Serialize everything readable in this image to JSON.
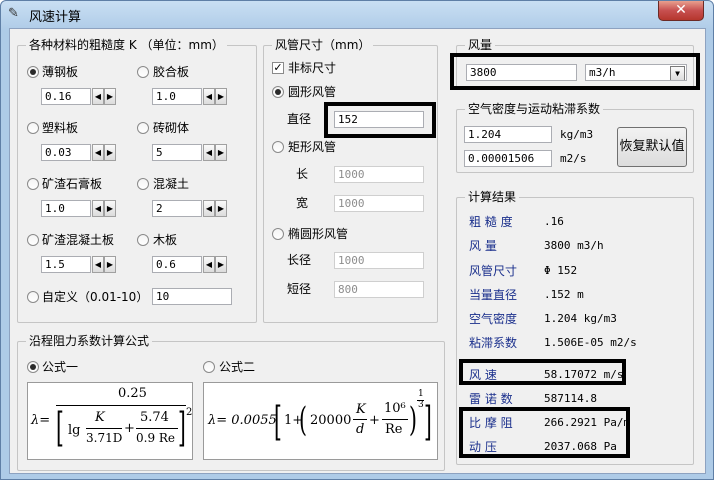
{
  "window": {
    "title": "风速计算",
    "close": "✕"
  },
  "materials": {
    "title": "各种材料的粗糙度 K  （单位：mm）",
    "items": [
      {
        "label": "薄钢板",
        "value": "0.16",
        "checked": true
      },
      {
        "label": "胶合板",
        "value": "1.0"
      },
      {
        "label": "塑料板",
        "value": "0.03"
      },
      {
        "label": "砖砌体",
        "value": "5"
      },
      {
        "label": "矿渣石膏板",
        "value": "1.0"
      },
      {
        "label": "混凝土",
        "value": "2"
      },
      {
        "label": "矿渣混凝土板",
        "value": "1.5"
      },
      {
        "label": "木板",
        "value": "0.6"
      }
    ],
    "custom": {
      "label": "自定义（0.01-10）",
      "value": "10"
    }
  },
  "duct": {
    "title": "风管尺寸（mm）",
    "nonstandard_label": "非标尺寸",
    "circular": {
      "label": "圆形风管",
      "diameter_label": "直径",
      "diameter_value": "152"
    },
    "rect": {
      "label": "矩形风管",
      "length_label": "长",
      "length_value": "1000",
      "width_label": "宽",
      "width_value": "1000"
    },
    "ellipse": {
      "label": "椭圆形风管",
      "major_label": "长径",
      "major_value": "1000",
      "minor_label": "短径",
      "minor_value": "800"
    }
  },
  "airflow": {
    "title": "风量",
    "value": "3800",
    "unit": "m3/h"
  },
  "air_props": {
    "title": "空气密度与运动粘滞系数",
    "density_value": "1.204",
    "density_unit": "kg/m3",
    "viscosity_value": "0.00001506",
    "viscosity_unit": "m2/s",
    "reset_label": "恢复默认值"
  },
  "results": {
    "title": "计算结果",
    "rows": [
      {
        "label": "粗 糙 度",
        "value": ".16"
      },
      {
        "label": "风    量",
        "value": "3800 m3/h"
      },
      {
        "label": "风管尺寸",
        "value": "Φ 152"
      },
      {
        "label": "当量直径",
        "value": ".152 m"
      },
      {
        "label": "空气密度",
        "value": "1.204 kg/m3"
      },
      {
        "label": "粘滞系数",
        "value": "1.506E-05 m2/s"
      },
      {
        "label": "风    速",
        "value": "58.17072 m/s"
      },
      {
        "label": "雷 诺 数",
        "value": "587114.8"
      },
      {
        "label": "比 摩 阻",
        "value": "266.2921 Pa/m"
      },
      {
        "label": "动    压",
        "value": "2037.068 Pa"
      }
    ]
  },
  "formula": {
    "title": "沿程阻力系数计算公式",
    "option1_label": "公式一",
    "option2_label": "公式二",
    "f1": {
      "lambda": "λ=",
      "numerator": "0.25",
      "lg": "lg",
      "k": "K",
      "d1": "3.71D",
      "plus": "+",
      "n2": "5.74",
      "d2": "0.9 Re",
      "exp": "2"
    },
    "f2": {
      "lambda": "λ= 0.0055",
      "one": "1+",
      "c": "20000",
      "k": "K",
      "d": "d",
      "plus": "+",
      "ten6": "10⁶",
      "re": "Re",
      "exp_n": "1",
      "exp_d": "3"
    }
  }
}
